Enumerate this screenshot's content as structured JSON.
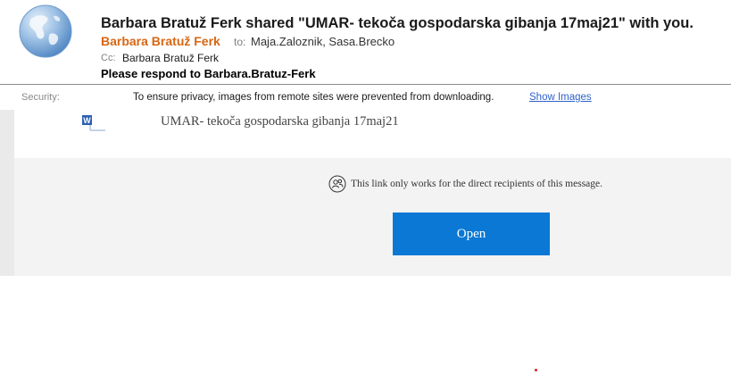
{
  "header": {
    "subject": "Barbara Bratuž Ferk shared \"UMAR- tekoča gospodarska gibanja 17maj21\" with you.",
    "sender": "Barbara Bratuž Ferk",
    "to_label": "to:",
    "to_value": "Maja.Zaloznik, Sasa.Brecko",
    "cc_label": "Cc:",
    "cc_value": "Barbara Bratuž Ferk",
    "respond_to": "Please respond to Barbara.Bratuz-Ferk"
  },
  "security": {
    "label": "Security:",
    "message": "To ensure privacy, images from remote sites were prevented from downloading.",
    "show_images_link": "Show Images"
  },
  "email_body": {
    "file_name": "UMAR- tekoča gospodarska gibanja 17maj21",
    "link_notice": "This link only works for the direct recipients of this message.",
    "open_button_label": "Open"
  },
  "colors": {
    "sender_orange": "#d86613",
    "link_blue": "#2e62c9",
    "open_button_blue": "#0a78d4",
    "body_background": "#f3f3f3"
  },
  "icons": {
    "avatar": "globe-avatar-icon",
    "file": "word-document-icon",
    "recipients": "people-icon"
  }
}
